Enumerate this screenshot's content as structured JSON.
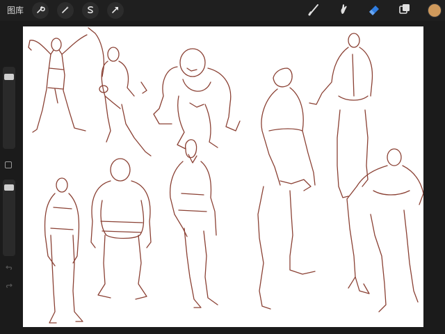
{
  "topbar": {
    "gallery_label": "图库",
    "left_tools": [
      {
        "name": "actions",
        "icon": "wrench-icon"
      },
      {
        "name": "adjustments",
        "icon": "magic-wand-icon"
      },
      {
        "name": "selection",
        "icon": "selection-s-icon"
      },
      {
        "name": "transform",
        "icon": "arrow-cursor-icon"
      }
    ],
    "right_tools": [
      {
        "name": "brush",
        "icon": "brush-icon",
        "active": false
      },
      {
        "name": "smudge",
        "icon": "smudge-icon",
        "active": false
      },
      {
        "name": "eraser",
        "icon": "eraser-icon",
        "active": true
      },
      {
        "name": "layers",
        "icon": "layers-icon",
        "active": false
      }
    ],
    "current_color": "#d09a5c",
    "active_tool_color": "#2f7de1"
  },
  "sidebar": {
    "brush_size_level": 0.92,
    "opacity_level": 0.95,
    "modify_button": "square-icon",
    "undo": "undo-icon",
    "redo": "redo-icon"
  },
  "canvas": {
    "background": "#ffffff",
    "line_color": "#8a4033",
    "content": "figure-drawing-sketches"
  }
}
